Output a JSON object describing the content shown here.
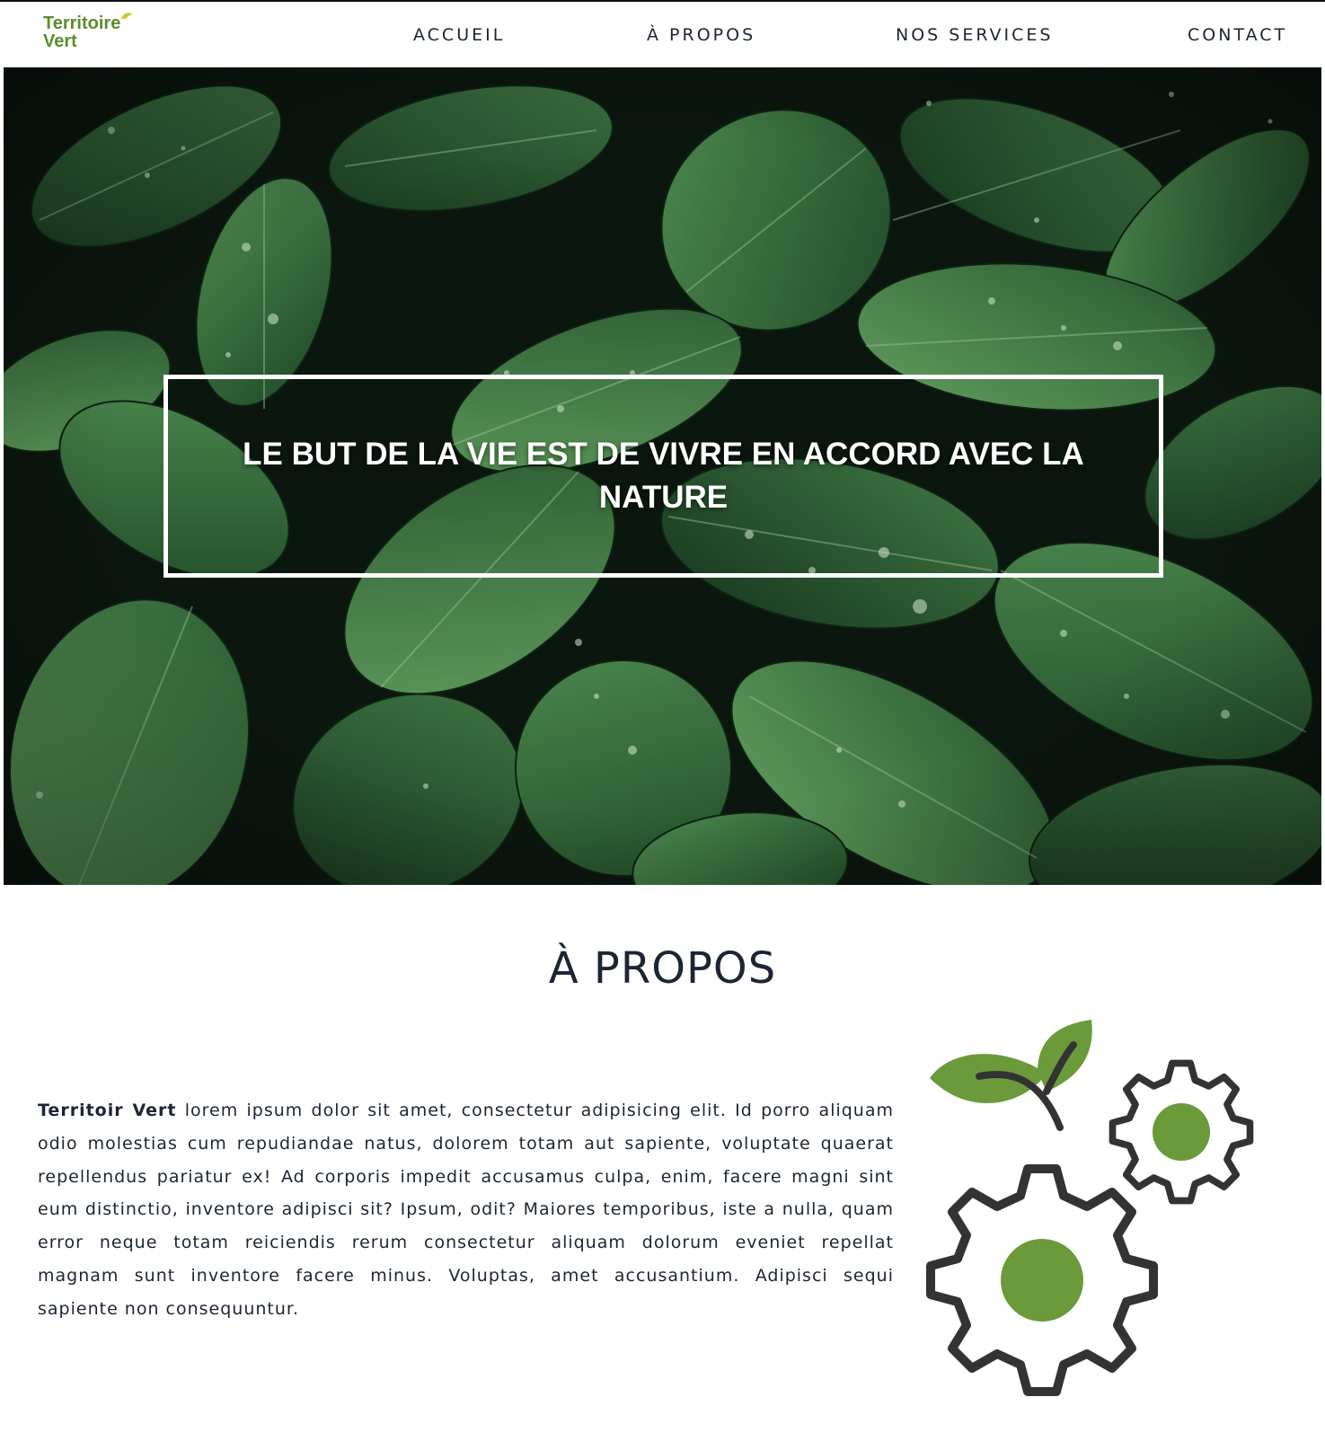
{
  "brand": {
    "line1": "Territoire",
    "line2": "Vert",
    "color": "#5a8e2e"
  },
  "nav": {
    "items": [
      {
        "label": "ACCUEIL"
      },
      {
        "label": "À PROPOS"
      },
      {
        "label": "NOS SERVICES"
      },
      {
        "label": "CONTACT"
      }
    ]
  },
  "hero": {
    "quote": "LE BUT DE LA VIE EST DE VIVRE EN ACCORD AVEC LA NATURE",
    "background": "green-leaves-photo"
  },
  "about": {
    "title": "À PROPOS",
    "brand_name": "Territoir Vert",
    "body": " lorem ipsum dolor sit amet, consectetur adipisicing elit. Id porro aliquam odio molestias cum repudiandae natus, dolorem totam aut sapiente, voluptate quaerat repellendus pariatur ex! Ad corporis impedit accusamus culpa, enim, facere magni sint eum distinctio, inventore adipisci sit? Ipsum, odit? Maiores temporibus, iste a nulla, quam error neque totam reiciendis rerum consectetur aliquam dolorum eveniet repellat magnam sunt inventore facere minus. Voluptas, amet accusantium. Adipisci sequi sapiente non consequuntur.",
    "illustration": "gears-with-leaves-icon"
  },
  "colors": {
    "accent_green": "#6a9a3a",
    "text_dark": "#1c2533",
    "gear_outline": "#333333"
  }
}
